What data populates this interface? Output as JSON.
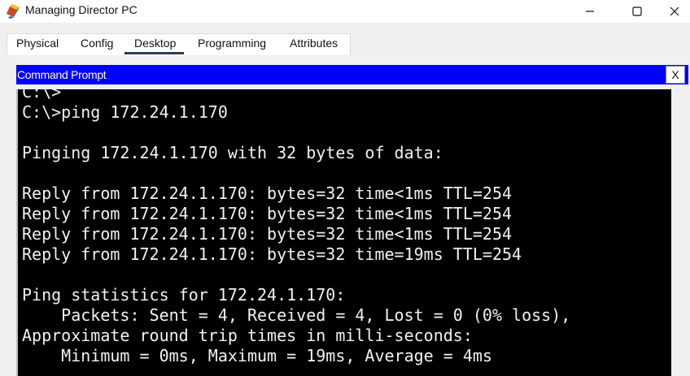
{
  "window": {
    "title": "Managing Director PC",
    "icon": "packet-tracer-pc-icon",
    "buttons": [
      "minimize",
      "maximize",
      "close"
    ]
  },
  "tabs": [
    {
      "label": "Physical",
      "active": false
    },
    {
      "label": "Config",
      "active": false
    },
    {
      "label": "Desktop",
      "active": true
    },
    {
      "label": "Programming",
      "active": false
    },
    {
      "label": "Attributes",
      "active": false
    }
  ],
  "command_prompt": {
    "title": "Command Prompt",
    "close_label": "X",
    "lines": [
      "C:\\>",
      "C:\\>ping 172.24.1.170",
      "",
      "Pinging 172.24.1.170 with 32 bytes of data:",
      "",
      "Reply from 172.24.1.170: bytes=32 time<1ms TTL=254",
      "Reply from 172.24.1.170: bytes=32 time<1ms TTL=254",
      "Reply from 172.24.1.170: bytes=32 time<1ms TTL=254",
      "Reply from 172.24.1.170: bytes=32 time=19ms TTL=254",
      "",
      "Ping statistics for 172.24.1.170:",
      "    Packets: Sent = 4, Received = 4, Lost = 0 (0% loss),",
      "Approximate round trip times in milli-seconds:",
      "    Minimum = 0ms, Maximum = 19ms, Average = 4ms"
    ]
  },
  "colors": {
    "prompt_header": "#0000ff",
    "console_bg": "#000000",
    "console_text": "#f2f2f2",
    "active_tab_underline": "#2b3e51"
  }
}
